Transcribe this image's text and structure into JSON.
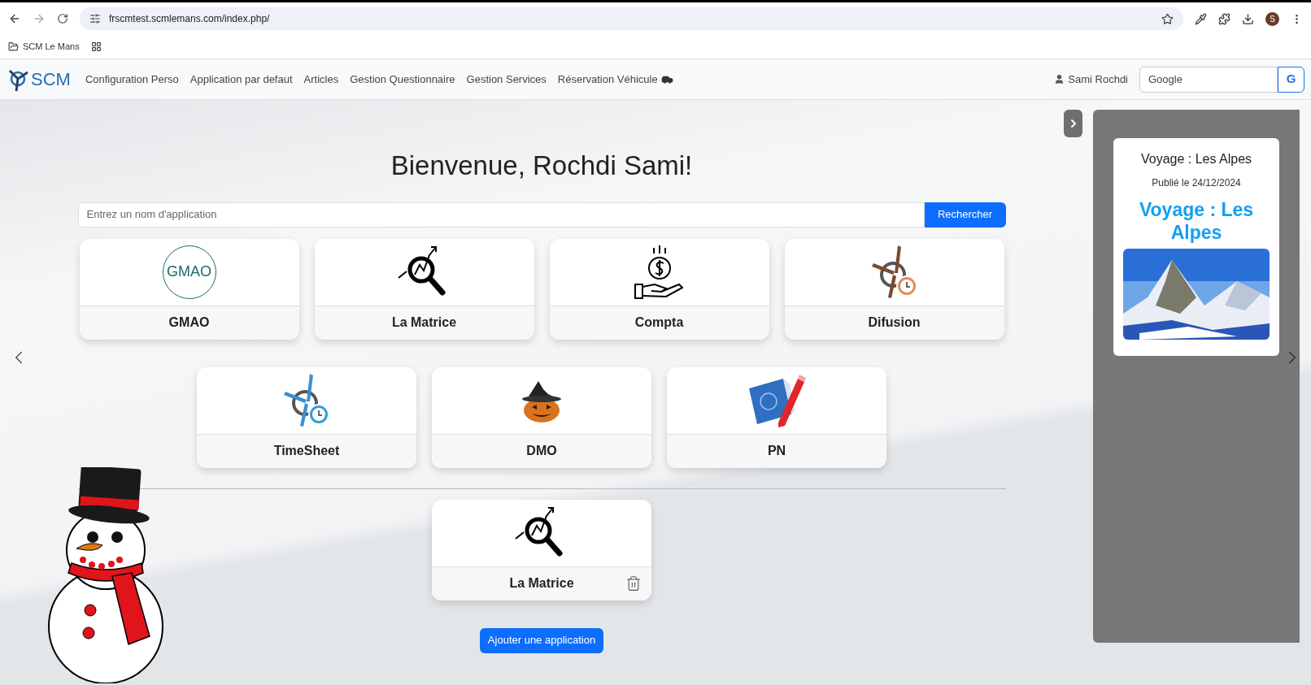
{
  "browser": {
    "url": "frscmtest.scmlemans.com/index.php/",
    "bookmarks": [
      {
        "label": "SCM Le Mans"
      }
    ],
    "profile": "S"
  },
  "navbar": {
    "brand": "SCM",
    "menu": [
      {
        "label": "Configuration Perso"
      },
      {
        "label": "Application par defaut"
      },
      {
        "label": "Articles"
      },
      {
        "label": "Gestion Questionnaire"
      },
      {
        "label": "Gestion Services"
      },
      {
        "label": "Réservation Véhicule",
        "kind": "car"
      }
    ],
    "user": "Sami Rochdi",
    "search_placeholder": "Google",
    "search_button": "G"
  },
  "main": {
    "title": "Bienvenue, Rochdi Sami!",
    "search_placeholder": "Entrez un nom d'application",
    "search_button": "Rechercher",
    "apps": [
      {
        "label": "GMAO",
        "kind": "gmao",
        "logo_text": "GMAO"
      },
      {
        "label": "La Matrice",
        "kind": "matrix"
      },
      {
        "label": "Compta",
        "kind": "money"
      },
      {
        "label": "Difusion",
        "kind": "turbine"
      },
      {
        "label": "TimeSheet",
        "kind": "timesheet"
      },
      {
        "label": "DMO",
        "kind": "pumpkin"
      },
      {
        "label": "PN",
        "kind": "blueprint"
      }
    ],
    "favorites": [
      {
        "label": "La Matrice",
        "kind": "matrix"
      }
    ],
    "add_button": "Ajouter une application"
  },
  "news": {
    "title": "Voyage : Les Alpes",
    "date": "Publié le 24/12/2024",
    "heading": "Voyage : Les Alpes"
  }
}
